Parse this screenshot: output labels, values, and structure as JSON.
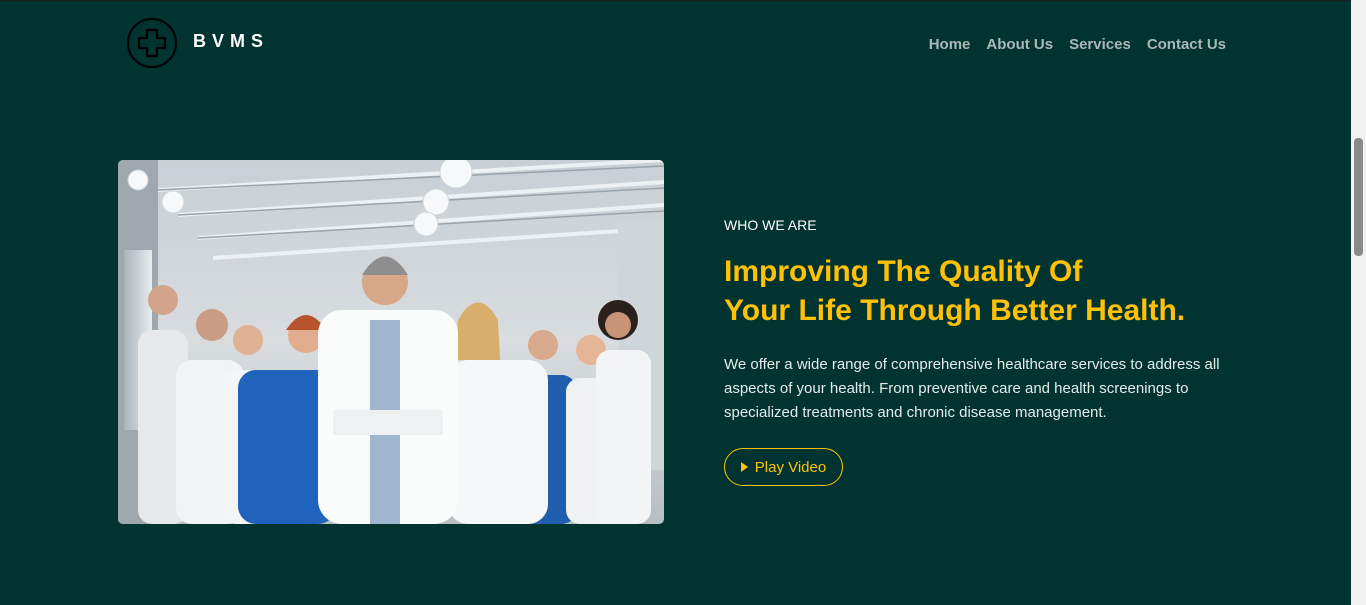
{
  "header": {
    "brand": "BVMS",
    "logo_icon": "medical-cross-icon",
    "nav": [
      {
        "label": "Home"
      },
      {
        "label": "About Us"
      },
      {
        "label": "Services"
      },
      {
        "label": "Contact Us"
      }
    ]
  },
  "hero": {
    "image": "medical-team-photo",
    "eyebrow": "WHO WE ARE",
    "headline_line1": "Improving The Quality Of",
    "headline_line2": "Your Life Through Better Health.",
    "description": "We offer a wide range of comprehensive healthcare services to address all aspects of your health. From preventive care and health screenings to specialized treatments and chronic disease management.",
    "play_button": {
      "label": "Play Video",
      "icon": "play-triangle-icon"
    }
  },
  "colors": {
    "background": "#013330",
    "accent": "#ffc107",
    "nav_text": "#aab8b6",
    "text": "#ffffff"
  }
}
